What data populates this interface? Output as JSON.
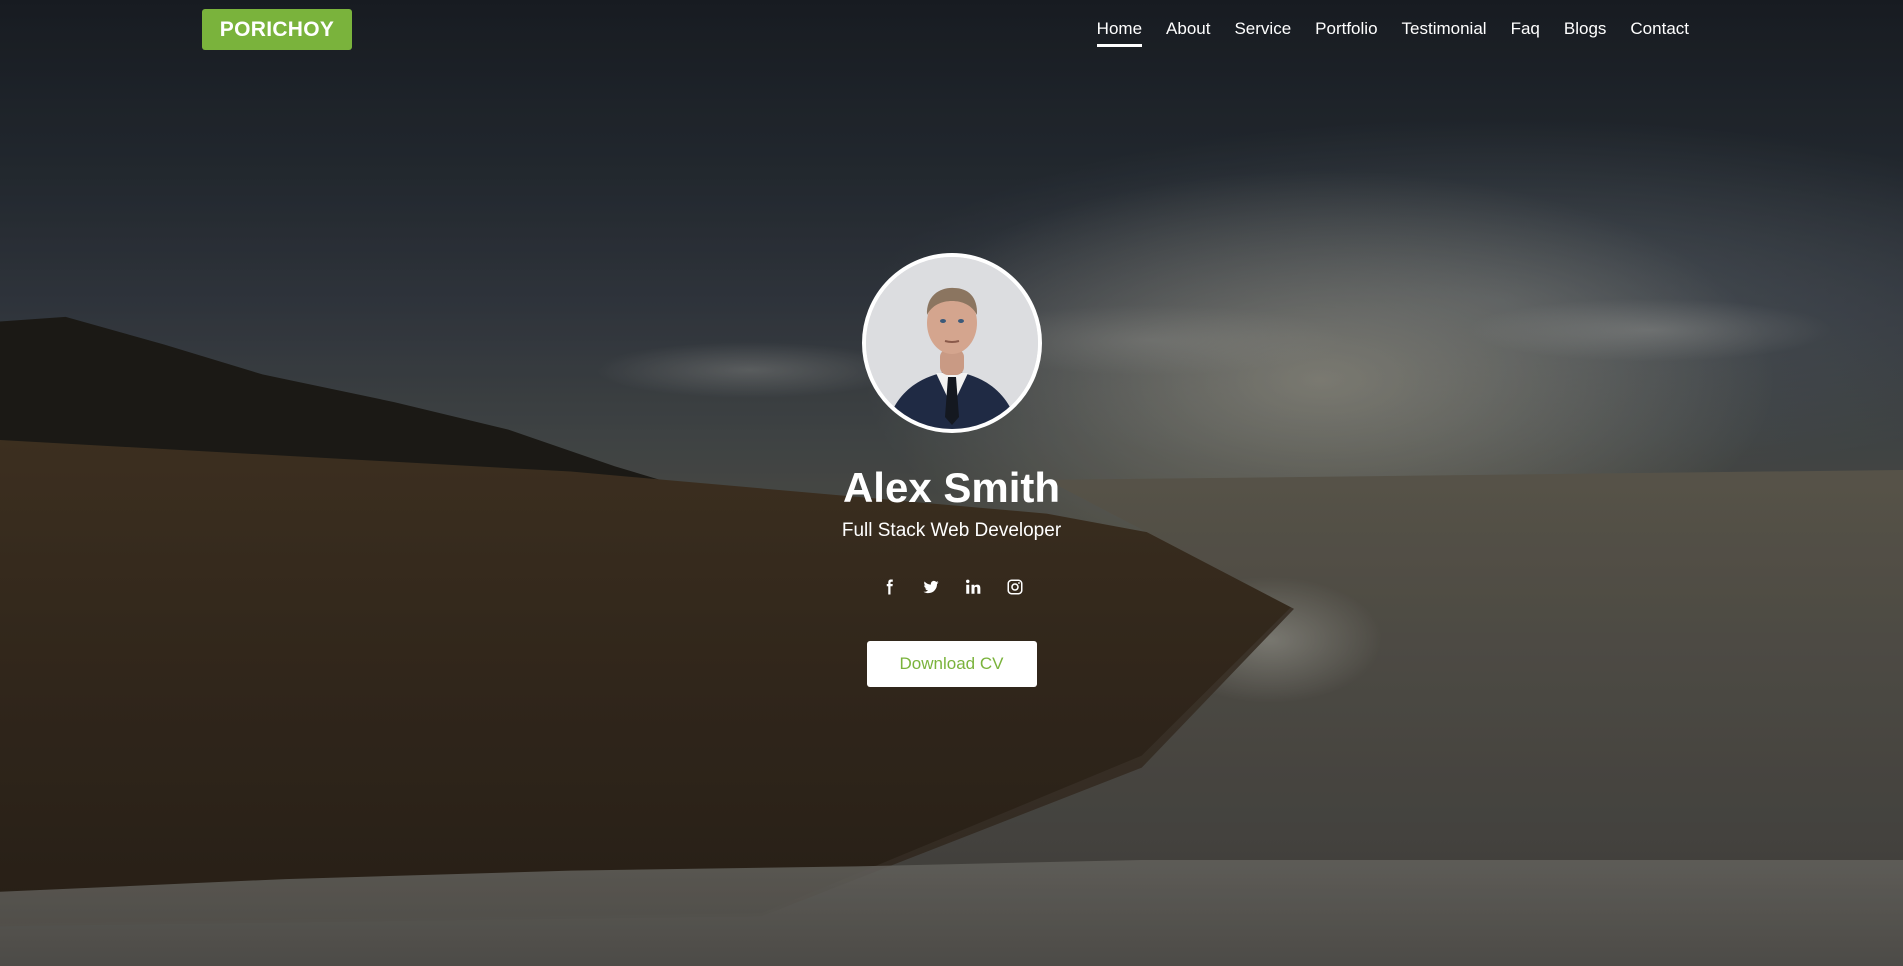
{
  "brand": {
    "logo_text": "PORICHOY",
    "accent_color": "#7ab33c"
  },
  "nav": {
    "items": [
      {
        "label": "Home",
        "active": true
      },
      {
        "label": "About",
        "active": false
      },
      {
        "label": "Service",
        "active": false
      },
      {
        "label": "Portfolio",
        "active": false
      },
      {
        "label": "Testimonial",
        "active": false
      },
      {
        "label": "Faq",
        "active": false
      },
      {
        "label": "Blogs",
        "active": false
      },
      {
        "label": "Contact",
        "active": false
      }
    ]
  },
  "profile": {
    "name": "Alex Smith",
    "role": "Full Stack Web Developer",
    "avatar_icon": "profile-photo"
  },
  "social": {
    "icons": [
      "facebook-icon",
      "twitter-icon",
      "linkedin-icon",
      "instagram-icon"
    ]
  },
  "cta": {
    "download_label": "Download CV"
  }
}
